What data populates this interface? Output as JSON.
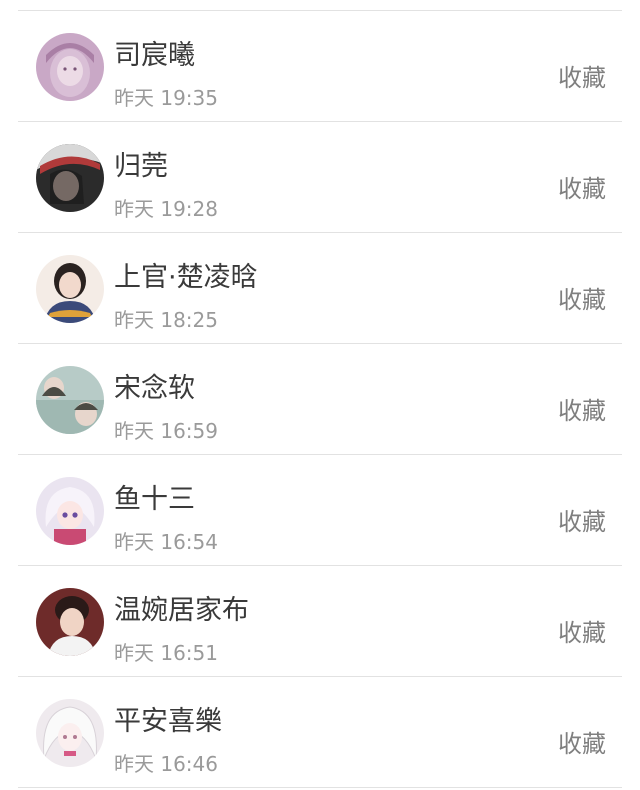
{
  "items": [
    {
      "name": "司宸曦",
      "time": "昨天 19:35",
      "action": "收藏",
      "avatar_color": "#c9a3c3"
    },
    {
      "name": "归莞",
      "time": "昨天 19:28",
      "action": "收藏",
      "avatar_color": "#2b2b2b"
    },
    {
      "name": "上官·楚凌晗",
      "time": "昨天 18:25",
      "action": "收藏",
      "avatar_color": "#f1e6de"
    },
    {
      "name": "宋念软",
      "time": "昨天 16:59",
      "action": "收藏",
      "avatar_color": "#a9c3bd"
    },
    {
      "name": "鱼十三",
      "time": "昨天 16:54",
      "action": "收藏",
      "avatar_color": "#e9d9ea"
    },
    {
      "name": "温婉居家布",
      "time": "昨天 16:51",
      "action": "收藏",
      "avatar_color": "#7b2e2c"
    },
    {
      "name": "平安喜樂",
      "time": "昨天 16:46",
      "action": "收藏",
      "avatar_color": "#ece6ea"
    }
  ]
}
